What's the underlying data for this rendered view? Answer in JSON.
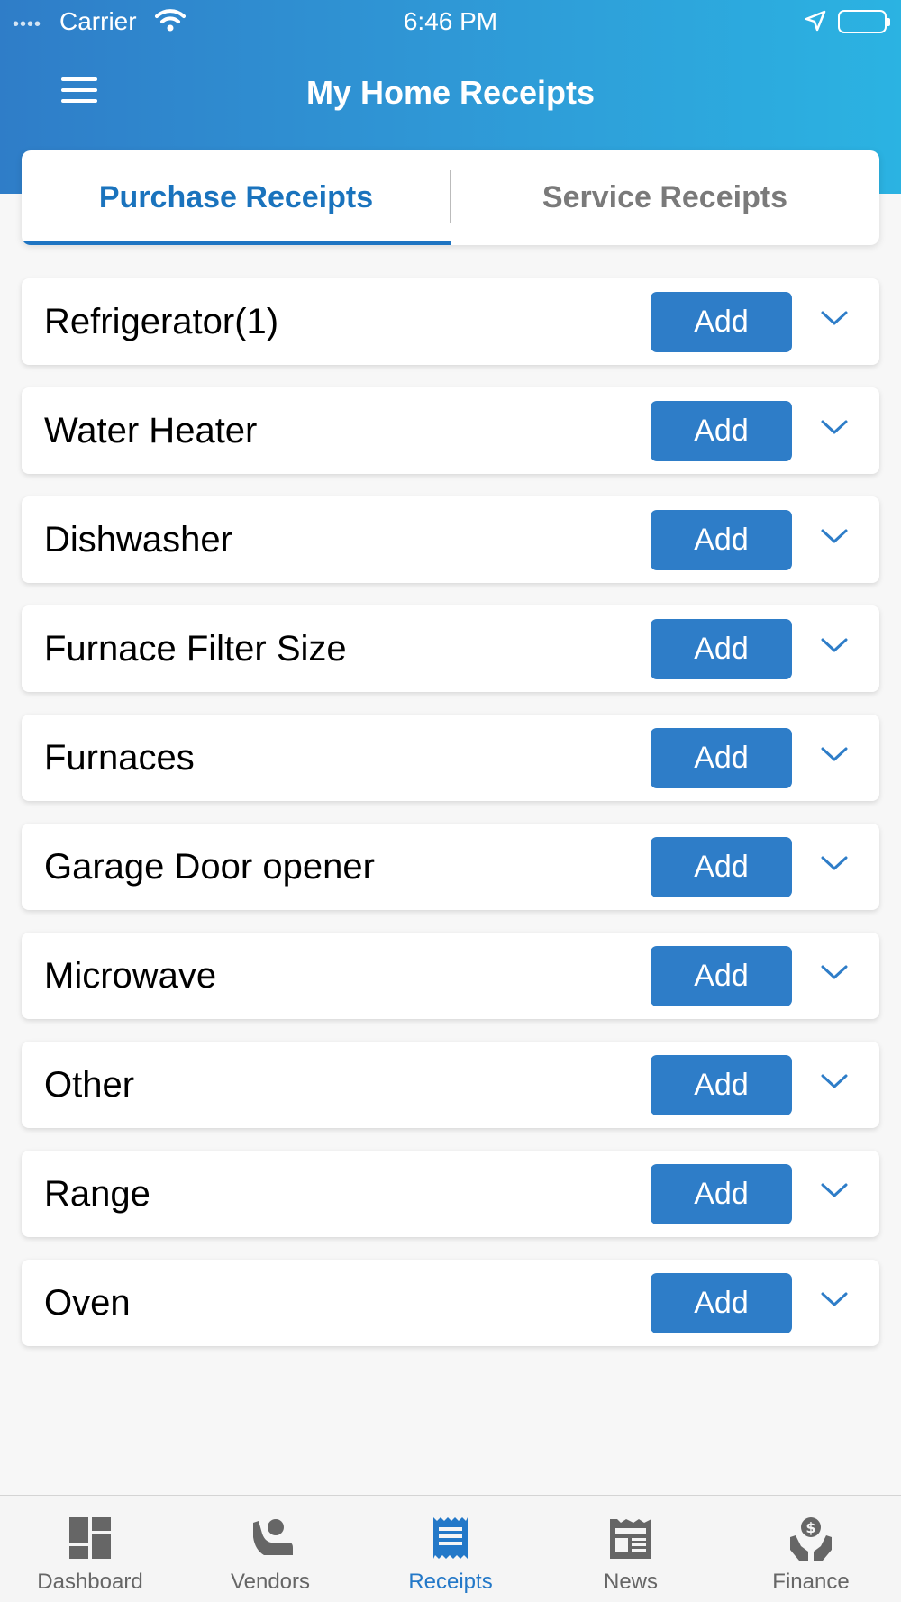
{
  "status": {
    "signal": "••••",
    "carrier": "Carrier",
    "time": "6:46 PM"
  },
  "header": {
    "title": "My Home Receipts"
  },
  "tabs": [
    {
      "label": "Purchase Receipts",
      "active": true
    },
    {
      "label": "Service Receipts",
      "active": false
    }
  ],
  "categories": [
    {
      "name": "Refrigerator(1)",
      "button": "Add"
    },
    {
      "name": "Water Heater",
      "button": "Add"
    },
    {
      "name": "Dishwasher",
      "button": "Add"
    },
    {
      "name": "Furnace Filter Size",
      "button": "Add"
    },
    {
      "name": "Furnaces",
      "button": "Add"
    },
    {
      "name": "Garage Door opener",
      "button": "Add"
    },
    {
      "name": "Microwave",
      "button": "Add"
    },
    {
      "name": "Other",
      "button": "Add"
    },
    {
      "name": "Range",
      "button": "Add"
    },
    {
      "name": "Oven",
      "button": "Add"
    }
  ],
  "tabbar": [
    {
      "label": "Dashboard",
      "icon": "dashboard-icon",
      "active": false
    },
    {
      "label": "Vendors",
      "icon": "vendors-icon",
      "active": false
    },
    {
      "label": "Receipts",
      "icon": "receipts-icon",
      "active": true
    },
    {
      "label": "News",
      "icon": "news-icon",
      "active": false
    },
    {
      "label": "Finance",
      "icon": "finance-icon",
      "active": false
    }
  ],
  "colors": {
    "primary": "#2e7dc8",
    "active_tab_text": "#1a73bd",
    "inactive_text": "#7a7a7a"
  }
}
